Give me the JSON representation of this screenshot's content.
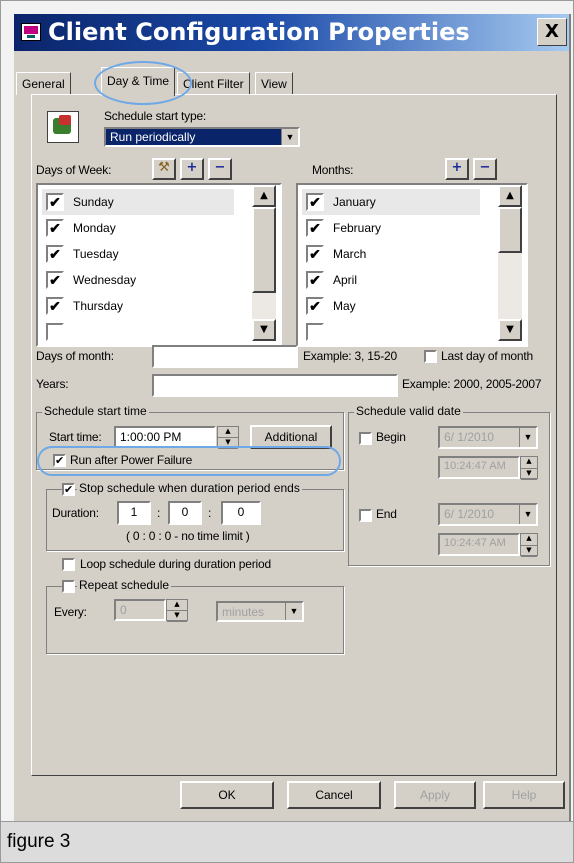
{
  "window": {
    "title": "Client Configuration Properties",
    "close": "X"
  },
  "tabs": [
    "General",
    "Day & Time",
    "Client Filter",
    "View"
  ],
  "schedule_start_type": {
    "label": "Schedule start type:",
    "value": "Run periodically"
  },
  "days_of_week": {
    "label": "Days of Week:",
    "items": [
      {
        "label": "Sunday",
        "checked": true,
        "selected": true
      },
      {
        "label": "Monday",
        "checked": true
      },
      {
        "label": "Tuesday",
        "checked": true
      },
      {
        "label": "Wednesday",
        "checked": true
      },
      {
        "label": "Thursday",
        "checked": true
      }
    ]
  },
  "months": {
    "label": "Months:",
    "items": [
      {
        "label": "January",
        "checked": true,
        "selected": true
      },
      {
        "label": "February",
        "checked": true
      },
      {
        "label": "March",
        "checked": true
      },
      {
        "label": "April",
        "checked": true
      },
      {
        "label": "May",
        "checked": true
      }
    ]
  },
  "days_of_month": {
    "label": "Days of month:",
    "value": "",
    "example": "Example: 3, 15-20",
    "last_day_label": "Last day of month",
    "last_day_checked": false
  },
  "years": {
    "label": "Years:",
    "value": "",
    "example": "Example: 2000, 2005-2007"
  },
  "schedule_start_time": {
    "group_label": "Schedule start time",
    "start_time_label": "Start time:",
    "start_time_value": "1:00:00 PM",
    "additional_button": "Additional",
    "run_after_power_failure": {
      "label": "Run after Power Failure",
      "checked": true
    }
  },
  "duration": {
    "stop_label": "Stop schedule when duration period ends",
    "stop_checked": true,
    "label": "Duration:",
    "hours": "1",
    "minutes": "0",
    "seconds": "0",
    "hint": "( 0 : 0 : 0 - no time limit )",
    "sep": ":"
  },
  "loop_schedule": {
    "label": "Loop schedule during duration period",
    "checked": false
  },
  "repeat_schedule": {
    "label": "Repeat schedule",
    "checked": false,
    "every_label": "Every:",
    "every_value": "0",
    "unit": "minutes"
  },
  "schedule_valid_date": {
    "group_label": "Schedule valid date",
    "begin_label": "Begin",
    "begin_checked": false,
    "begin_date": "6/ 1/2010",
    "begin_time": "10:24:47 AM",
    "end_label": "End",
    "end_checked": false,
    "end_date": "6/ 1/2010",
    "end_time": "10:24:47 AM"
  },
  "buttons": {
    "ok": "OK",
    "cancel": "Cancel",
    "apply": "Apply",
    "help": "Help"
  },
  "caption": "figure 3",
  "icons": {
    "check": "✔",
    "up": "▲",
    "down": "▼",
    "plus": "+",
    "minus": "−",
    "tools": "⚒"
  }
}
